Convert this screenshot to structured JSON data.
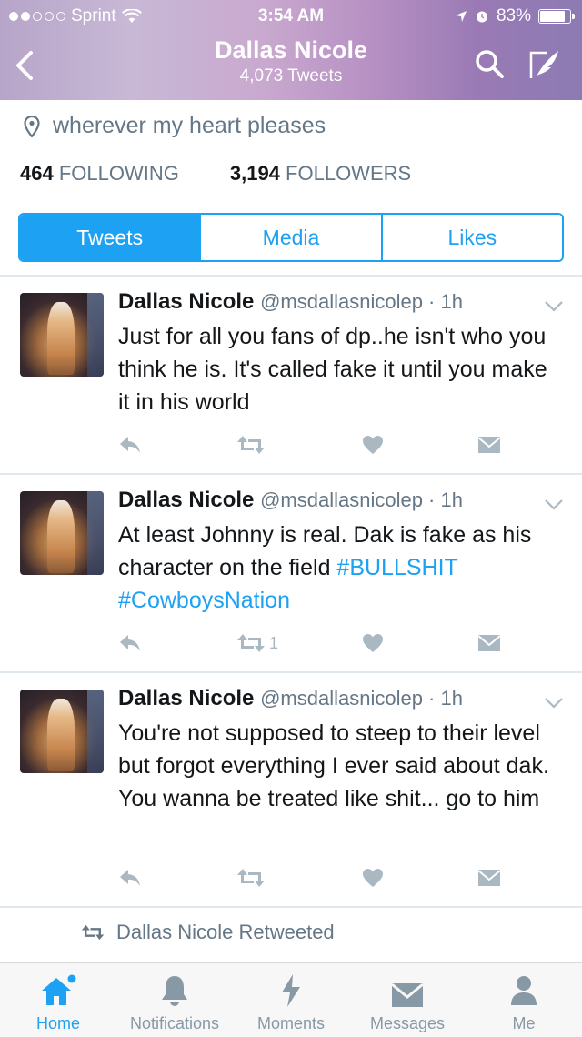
{
  "status_bar": {
    "carrier": "Sprint",
    "time": "3:54 AM",
    "battery": "83%",
    "battery_level": 0.83
  },
  "header": {
    "title": "Dallas Nicole",
    "subtitle": "4,073 Tweets",
    "back_icon": "chevron-left-icon",
    "search_icon": "search-icon",
    "compose_icon": "compose-icon"
  },
  "profile": {
    "location": "wherever my heart pleases",
    "following_count": "464",
    "following_label": "FOLLOWING",
    "followers_count": "3,194",
    "followers_label": "FOLLOWERS"
  },
  "tabs": [
    {
      "label": "Tweets",
      "active": true
    },
    {
      "label": "Media",
      "active": false
    },
    {
      "label": "Likes",
      "active": false
    }
  ],
  "tweets": [
    {
      "name": "Dallas Nicole",
      "handle": "@msdallasnicolep",
      "time": "1h",
      "text": "Just for all you fans of dp..he isn't who you think he is. It's called fake it until you make it in his world",
      "retweets": ""
    },
    {
      "name": "Dallas Nicole",
      "handle": "@msdallasnicolep",
      "time": "1h",
      "text_plain": "At least Johnny is real. Dak is fake as his character on the field ",
      "hashtag1": "#BULLSHIT",
      "hashtag2": "#CowboysNation",
      "retweets": "1"
    },
    {
      "name": "Dallas Nicole",
      "handle": "@msdallasnicolep",
      "time": "1h",
      "text": "You're not supposed to steep to their level but forgot everything I ever said about dak. You wanna be treated like shit... go to him",
      "retweets": ""
    }
  ],
  "retweeted_line": "Dallas Nicole Retweeted",
  "tab_bar": [
    {
      "label": "Home",
      "icon": "home-icon",
      "active": true
    },
    {
      "label": "Notifications",
      "icon": "bell-icon",
      "active": false
    },
    {
      "label": "Moments",
      "icon": "lightning-icon",
      "active": false
    },
    {
      "label": "Messages",
      "icon": "envelope-icon",
      "active": false
    },
    {
      "label": "Me",
      "icon": "person-icon",
      "active": false
    }
  ],
  "colors": {
    "accent": "#1da1f2",
    "muted": "#657786",
    "icon_gray": "#aab8c2"
  }
}
